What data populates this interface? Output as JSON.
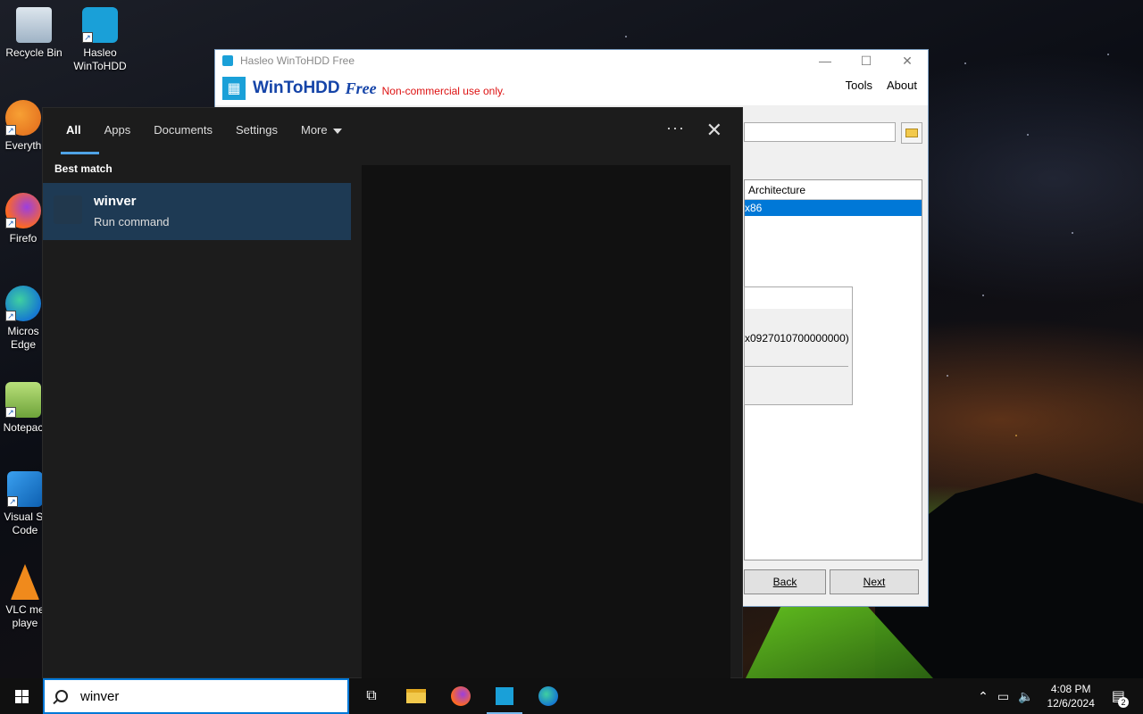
{
  "desktop": {
    "icons": [
      {
        "label": "Recycle Bin"
      },
      {
        "label": "Hasleo WinToHDD"
      },
      {
        "label": "Everyth"
      },
      {
        "label": "Firefo"
      },
      {
        "label": "Micros Edge"
      },
      {
        "label": "Notepac"
      },
      {
        "label": "Visual St Code"
      },
      {
        "label": "VLC me playe"
      }
    ]
  },
  "wintohdd": {
    "title": "Hasleo WinToHDD Free",
    "brand": "WinToHDD",
    "brand_free": "Free",
    "brand_note": "Non-commercial use only.",
    "menu": {
      "tools": "Tools",
      "about": "About"
    },
    "list": {
      "column_architecture": "Architecture",
      "selected_value": "x86"
    },
    "dialog_text": "x0927010700000000)",
    "buttons": {
      "back": "Back",
      "next": "Next"
    }
  },
  "search_panel": {
    "tabs": [
      "All",
      "Apps",
      "Documents",
      "Settings",
      "More"
    ],
    "more_options": "···",
    "best_match_label": "Best match",
    "result": {
      "name": "winver",
      "subtitle": "Run command"
    }
  },
  "taskbar": {
    "search_query": "winver",
    "time": "4:08 PM",
    "date": "12/6/2024",
    "notification_count": "2"
  },
  "colors": {
    "accent": "#0078d7",
    "result_highlight": "#1e3a54",
    "panel_bg": "#1c1c1c"
  }
}
